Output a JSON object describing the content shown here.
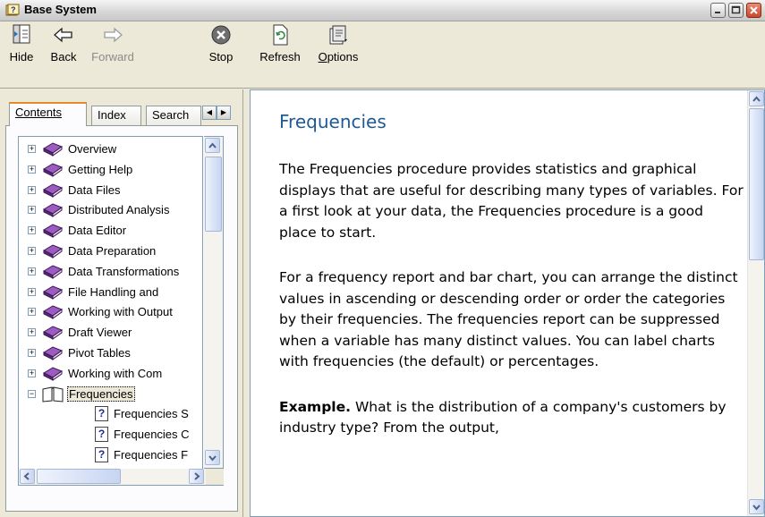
{
  "window": {
    "title": "Base System"
  },
  "toolbar": {
    "hide": "Hide",
    "back": "Back",
    "forward": "Forward",
    "stop": "Stop",
    "refresh": "Refresh",
    "options": "Options"
  },
  "tabs": {
    "contents": "Contents",
    "index": "Index",
    "search": "Search"
  },
  "tree": {
    "books": [
      "Overview",
      "Getting Help",
      "Data Files",
      "Distributed Analysis",
      "Data Editor",
      "Data Preparation",
      "Data Transformations",
      "File Handling and",
      "Working with Output",
      "Draft Viewer",
      "Pivot Tables",
      "Working with Com",
      "Frequencies"
    ],
    "topics": [
      "Frequencies S",
      "Frequencies C",
      "Frequencies F"
    ]
  },
  "content": {
    "title": "Frequencies",
    "para1": "The Frequencies procedure provides statistics and graphical displays that are useful for describing many types of variables. For a first look at your data, the Frequencies procedure is a good place to start.",
    "para2": "For a frequency report and bar chart, you can arrange the distinct values in ascending or descending order or order the categories by their frequencies. The frequencies report can be suppressed when a variable has many distinct values. You can label charts with frequencies (the default) or percentages.",
    "example_label": "Example.",
    "example_text": " What is the distribution of a company's customers by industry type? From the output,"
  },
  "colors": {
    "heading": "#1f5a96",
    "book": "#7a3d9c",
    "selection": "#ece9d8"
  }
}
